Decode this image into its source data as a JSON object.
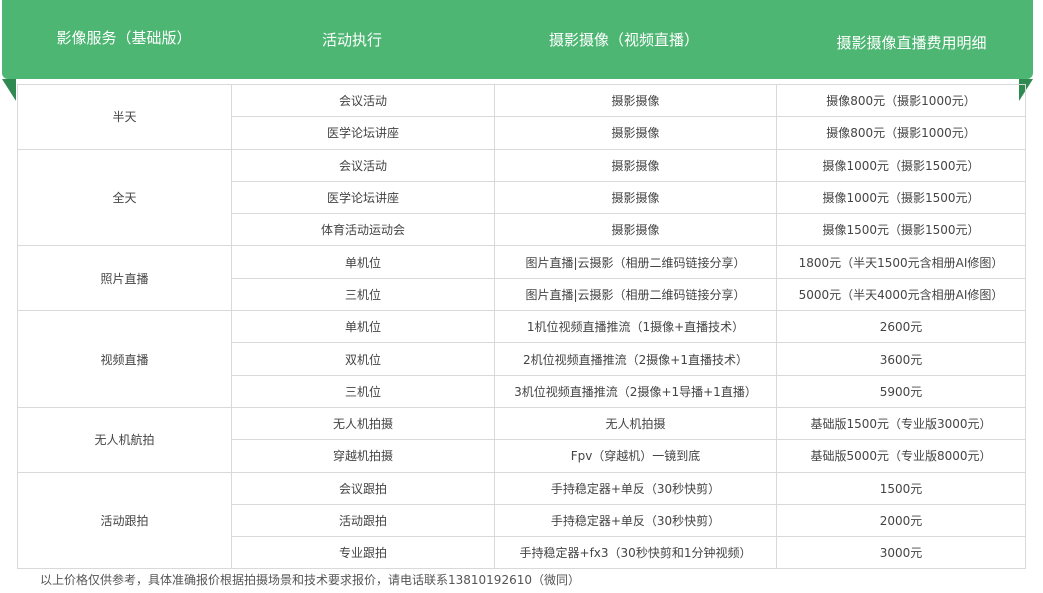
{
  "header": {
    "col1": "影像服务（基础版）",
    "col2": "活动执行",
    "col3": "摄影摄像（视频直播）",
    "col4": "摄影摄像直播费用明细"
  },
  "groups": [
    {
      "name": "半天",
      "rows": [
        {
          "activity": "会议活动",
          "service": "摄影摄像",
          "price": "摄像800元（摄影1000元）"
        },
        {
          "activity": "医学论坛讲座",
          "service": "摄影摄像",
          "price": "摄像800元（摄影1000元）"
        }
      ]
    },
    {
      "name": "全天",
      "rows": [
        {
          "activity": "会议活动",
          "service": "摄影摄像",
          "price": "摄像1000元（摄影1500元）"
        },
        {
          "activity": "医学论坛讲座",
          "service": "摄影摄像",
          "price": "摄像1000元（摄影1500元）"
        },
        {
          "activity": "体育活动运动会",
          "service": "摄影摄像",
          "price": "摄像1500元（摄影1500元）"
        }
      ]
    },
    {
      "name": "照片直播",
      "rows": [
        {
          "activity": "单机位",
          "service": "图片直播|云摄影（相册二维码链接分享）",
          "price": "1800元（半天1500元含相册AI修图）"
        },
        {
          "activity": "三机位",
          "service": "图片直播|云摄影（相册二维码链接分享）",
          "price": "5000元（半天4000元含相册AI修图）"
        }
      ]
    },
    {
      "name": "视频直播",
      "rows": [
        {
          "activity": "单机位",
          "service": "1机位视频直播推流（1摄像+直播技术）",
          "price": "2600元"
        },
        {
          "activity": "双机位",
          "service": "2机位视频直播推流（2摄像+1直播技术）",
          "price": "3600元"
        },
        {
          "activity": "三机位",
          "service": "3机位视频直播推流（2摄像+1导播+1直播）",
          "price": "5900元"
        }
      ]
    },
    {
      "name": "无人机航拍",
      "rows": [
        {
          "activity": "无人机拍摄",
          "service": "无人机拍摄",
          "price": "基础版1500元（专业版3000元）"
        },
        {
          "activity": "穿越机拍摄",
          "service": "Fpv（穿越机）一镜到底",
          "price": "基础版5000元（专业版8000元）"
        }
      ]
    },
    {
      "name": "活动跟拍",
      "rows": [
        {
          "activity": "会议跟拍",
          "service": "手持稳定器+单反（30秒快剪）",
          "price": "1500元"
        },
        {
          "activity": "活动跟拍",
          "service": "手持稳定器+单反（30秒快剪）",
          "price": "2000元"
        },
        {
          "activity": "专业跟拍",
          "service": "手持稳定器+fx3（30秒快剪和1分钟视频）",
          "price": "3000元"
        }
      ]
    }
  ],
  "note": "以上价格仅供参考，具体准确报价根据拍摄场景和技术要求报价，请电话联系13810192610（微同）",
  "colors": {
    "header_green": "#4cb672",
    "fold_green": "#2f8a52",
    "border": "#d9d9d9"
  }
}
